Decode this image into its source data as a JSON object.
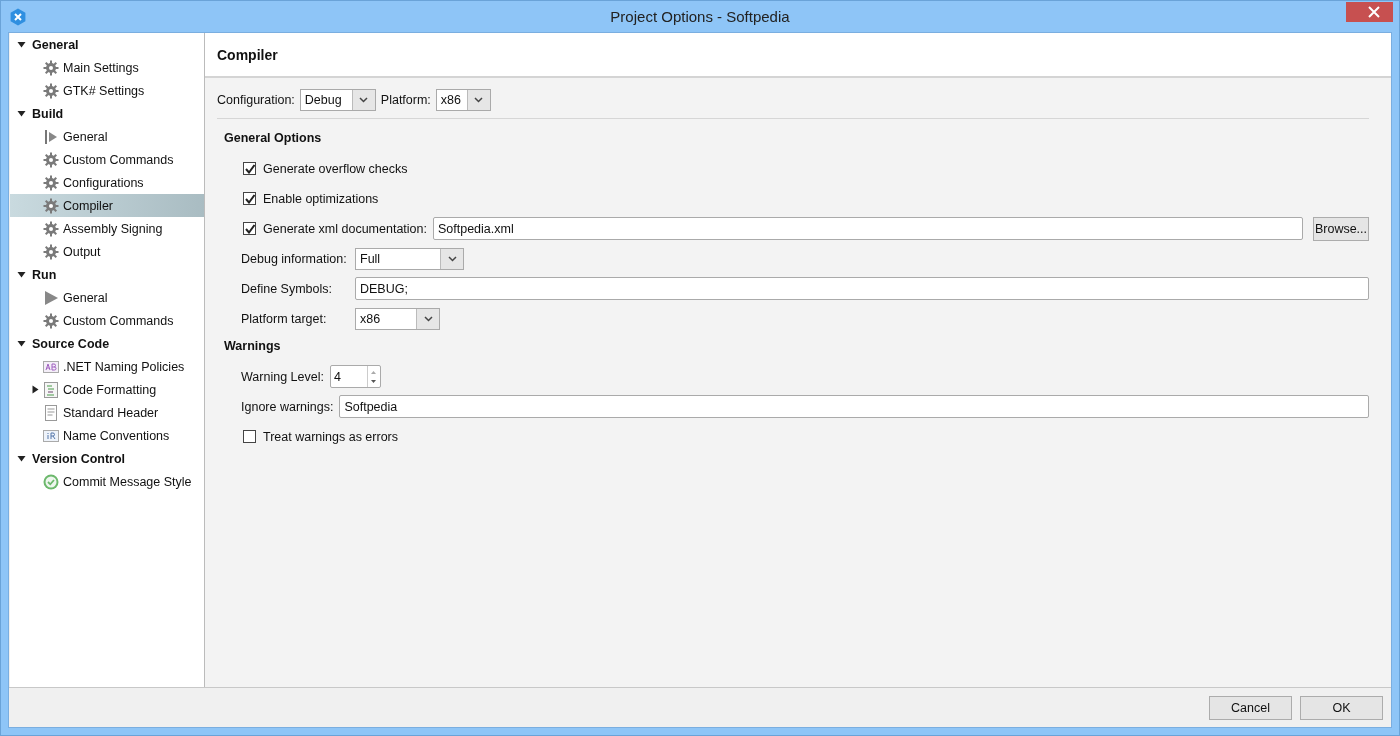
{
  "window": {
    "title": "Project Options - Softpedia"
  },
  "sidebar": {
    "categories": [
      {
        "label": "General",
        "expanded": true,
        "items": [
          {
            "label": "Main Settings",
            "kind": "gear",
            "selected": false,
            "expandable": false
          },
          {
            "label": "GTK# Settings",
            "kind": "gear",
            "selected": false,
            "expandable": false
          }
        ]
      },
      {
        "label": "Build",
        "expanded": true,
        "items": [
          {
            "label": "General",
            "kind": "build",
            "selected": false,
            "expandable": false
          },
          {
            "label": "Custom Commands",
            "kind": "gear",
            "selected": false,
            "expandable": false
          },
          {
            "label": "Configurations",
            "kind": "gear",
            "selected": false,
            "expandable": false
          },
          {
            "label": "Compiler",
            "kind": "gear",
            "selected": true,
            "expandable": false
          },
          {
            "label": "Assembly Signing",
            "kind": "gear",
            "selected": false,
            "expandable": false
          },
          {
            "label": "Output",
            "kind": "gear",
            "selected": false,
            "expandable": false
          }
        ]
      },
      {
        "label": "Run",
        "expanded": true,
        "items": [
          {
            "label": "General",
            "kind": "play",
            "selected": false,
            "expandable": false
          },
          {
            "label": "Custom Commands",
            "kind": "gear",
            "selected": false,
            "expandable": false
          }
        ]
      },
      {
        "label": "Source Code",
        "expanded": true,
        "items": [
          {
            "label": ".NET Naming Policies",
            "kind": "naming",
            "selected": false,
            "expandable": false
          },
          {
            "label": "Code Formatting",
            "kind": "format",
            "selected": false,
            "expandable": true
          },
          {
            "label": "Standard Header",
            "kind": "document",
            "selected": false,
            "expandable": false
          },
          {
            "label": "Name Conventions",
            "kind": "conventions",
            "selected": false,
            "expandable": false
          }
        ]
      },
      {
        "label": "Version Control",
        "expanded": true,
        "items": [
          {
            "label": "Commit Message Style",
            "kind": "check",
            "selected": false,
            "expandable": false
          }
        ]
      }
    ]
  },
  "page": {
    "title": "Compiler",
    "configuration": {
      "label": "Configuration:",
      "value": "Debug"
    },
    "platform": {
      "label": "Platform:",
      "value": "x86"
    },
    "sections": [
      {
        "title": "General Options",
        "rows": [
          {
            "kind": "checkbox",
            "label": "Generate overflow checks",
            "checked": true
          },
          {
            "kind": "checkbox",
            "label": "Enable optimizations",
            "checked": true
          },
          {
            "kind": "checkfield",
            "label": "Generate xml documentation:",
            "checked": true,
            "value": "Softpedia.xml",
            "button": "Browse..."
          },
          {
            "kind": "combo",
            "label": "Debug information:",
            "value": "Full"
          },
          {
            "kind": "text",
            "label": "Define Symbols:",
            "value": "DEBUG;"
          },
          {
            "kind": "combo",
            "label": "Platform target:",
            "value": "x86"
          }
        ]
      },
      {
        "title": "Warnings",
        "rows": [
          {
            "kind": "spin",
            "label": "Warning Level:",
            "value": "4"
          },
          {
            "kind": "text",
            "label": "Ignore warnings:",
            "value": "Softpedia"
          },
          {
            "kind": "checkbox",
            "label": "Treat warnings as errors",
            "checked": false
          }
        ]
      }
    ]
  },
  "buttons": [
    "Cancel",
    "OK"
  ]
}
